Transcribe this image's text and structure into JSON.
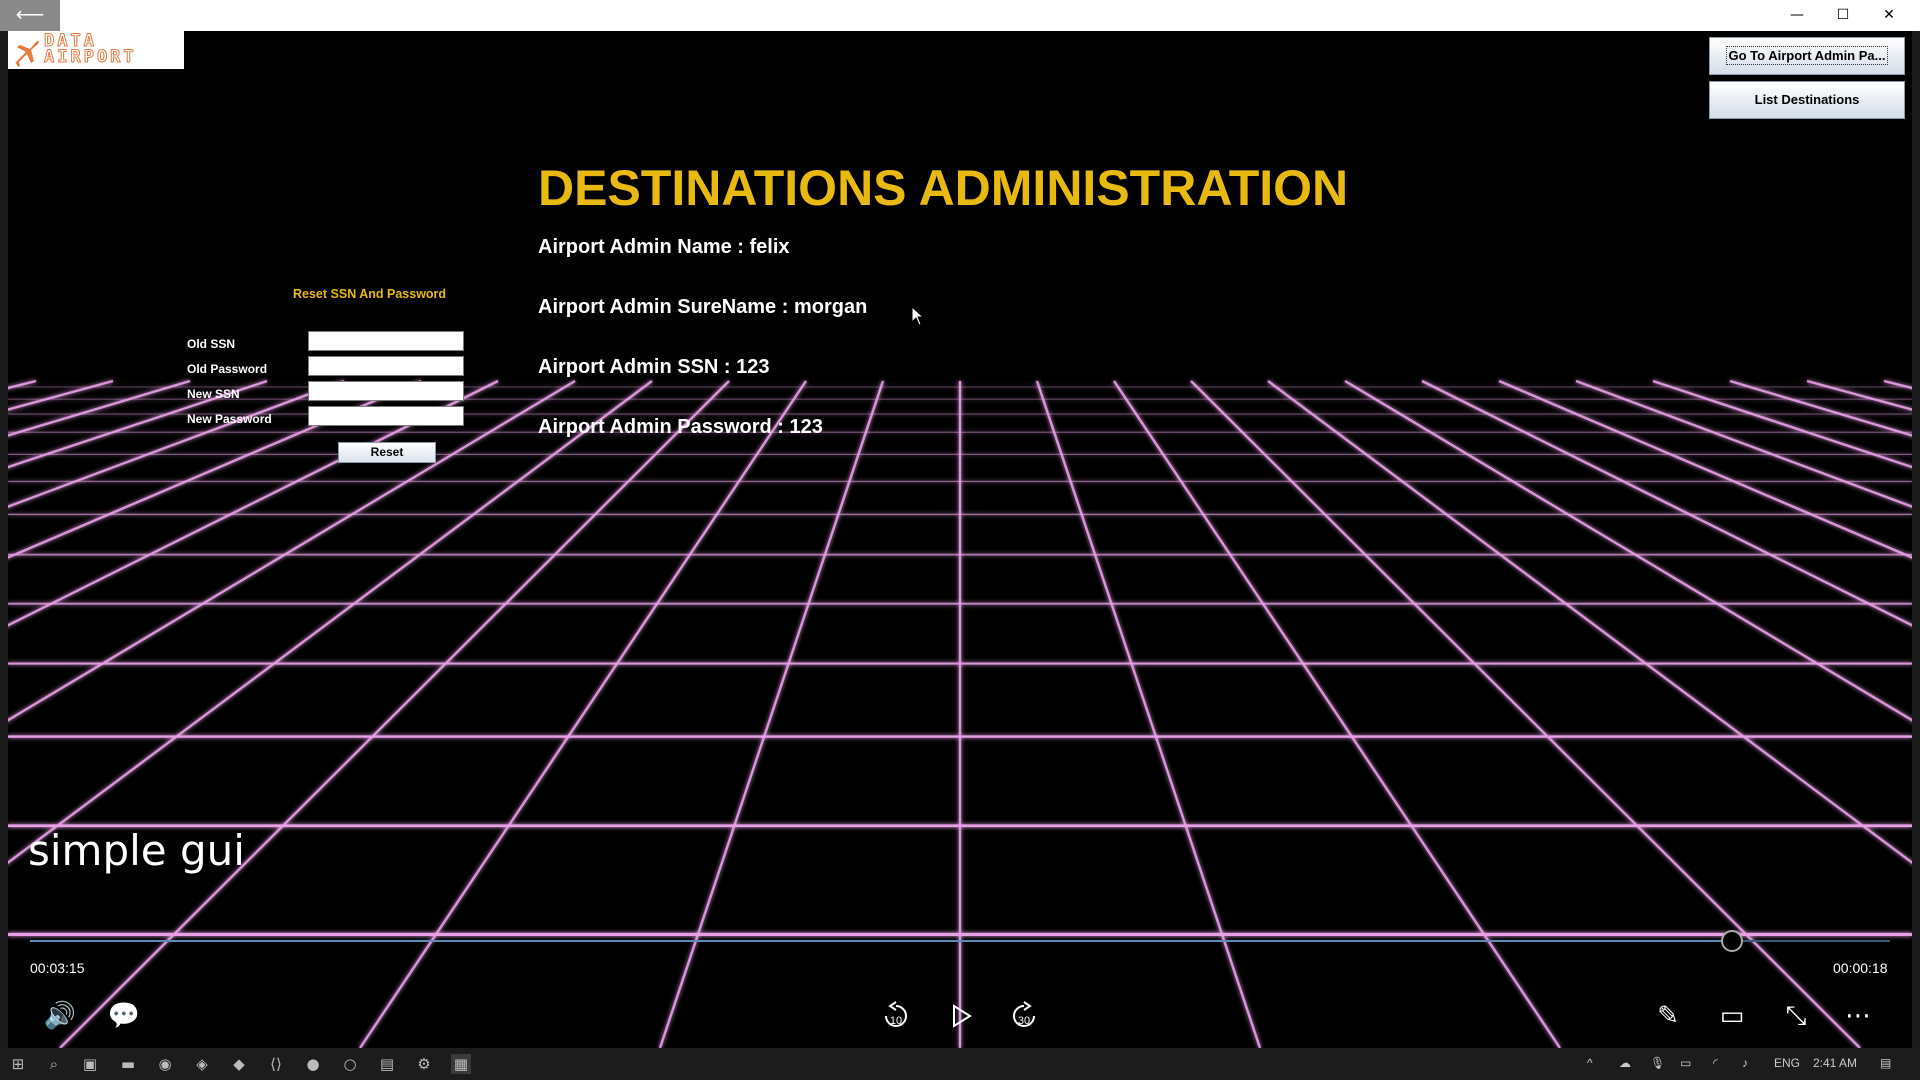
{
  "window": {
    "back_icon": "arrow-left-icon",
    "controls": [
      "—",
      "☐",
      "✕"
    ]
  },
  "app": {
    "logo_text_line1": "DATA",
    "logo_text_line2": "AIRPORT",
    "title": "DESTINATIONS ADMINISTRATION",
    "admin_name": "Airport Admin Name : felix",
    "admin_surname": "Airport Admin SureName : morgan",
    "admin_ssn": "Airport Admin SSN : 123",
    "admin_password": "Airport Admin Password : 123",
    "buttons": {
      "go_to_admin": "Go To Airport Admin Pa...",
      "list_destinations": "List Destinations"
    },
    "reset_form": {
      "title": "Reset SSN And Password",
      "old_ssn_label": "Old SSN",
      "old_password_label": "Old Password",
      "new_ssn_label": "New SSN",
      "new_password_label": "New Password",
      "old_ssn_value": "",
      "old_password_value": "",
      "new_ssn_value": "",
      "new_password_value": "",
      "reset_label": "Reset"
    }
  },
  "player": {
    "caption": "simple gui",
    "elapsed": "00:03:15",
    "remaining": "00:00:18",
    "progress": 0.915,
    "skip_back": "10",
    "skip_forward": "30"
  },
  "taskbar": {
    "language": "ENG",
    "clock": "2:41 AM"
  },
  "colors": {
    "heading": "#e8b90f",
    "grid": "#e9a0e8",
    "background": "#000000"
  }
}
